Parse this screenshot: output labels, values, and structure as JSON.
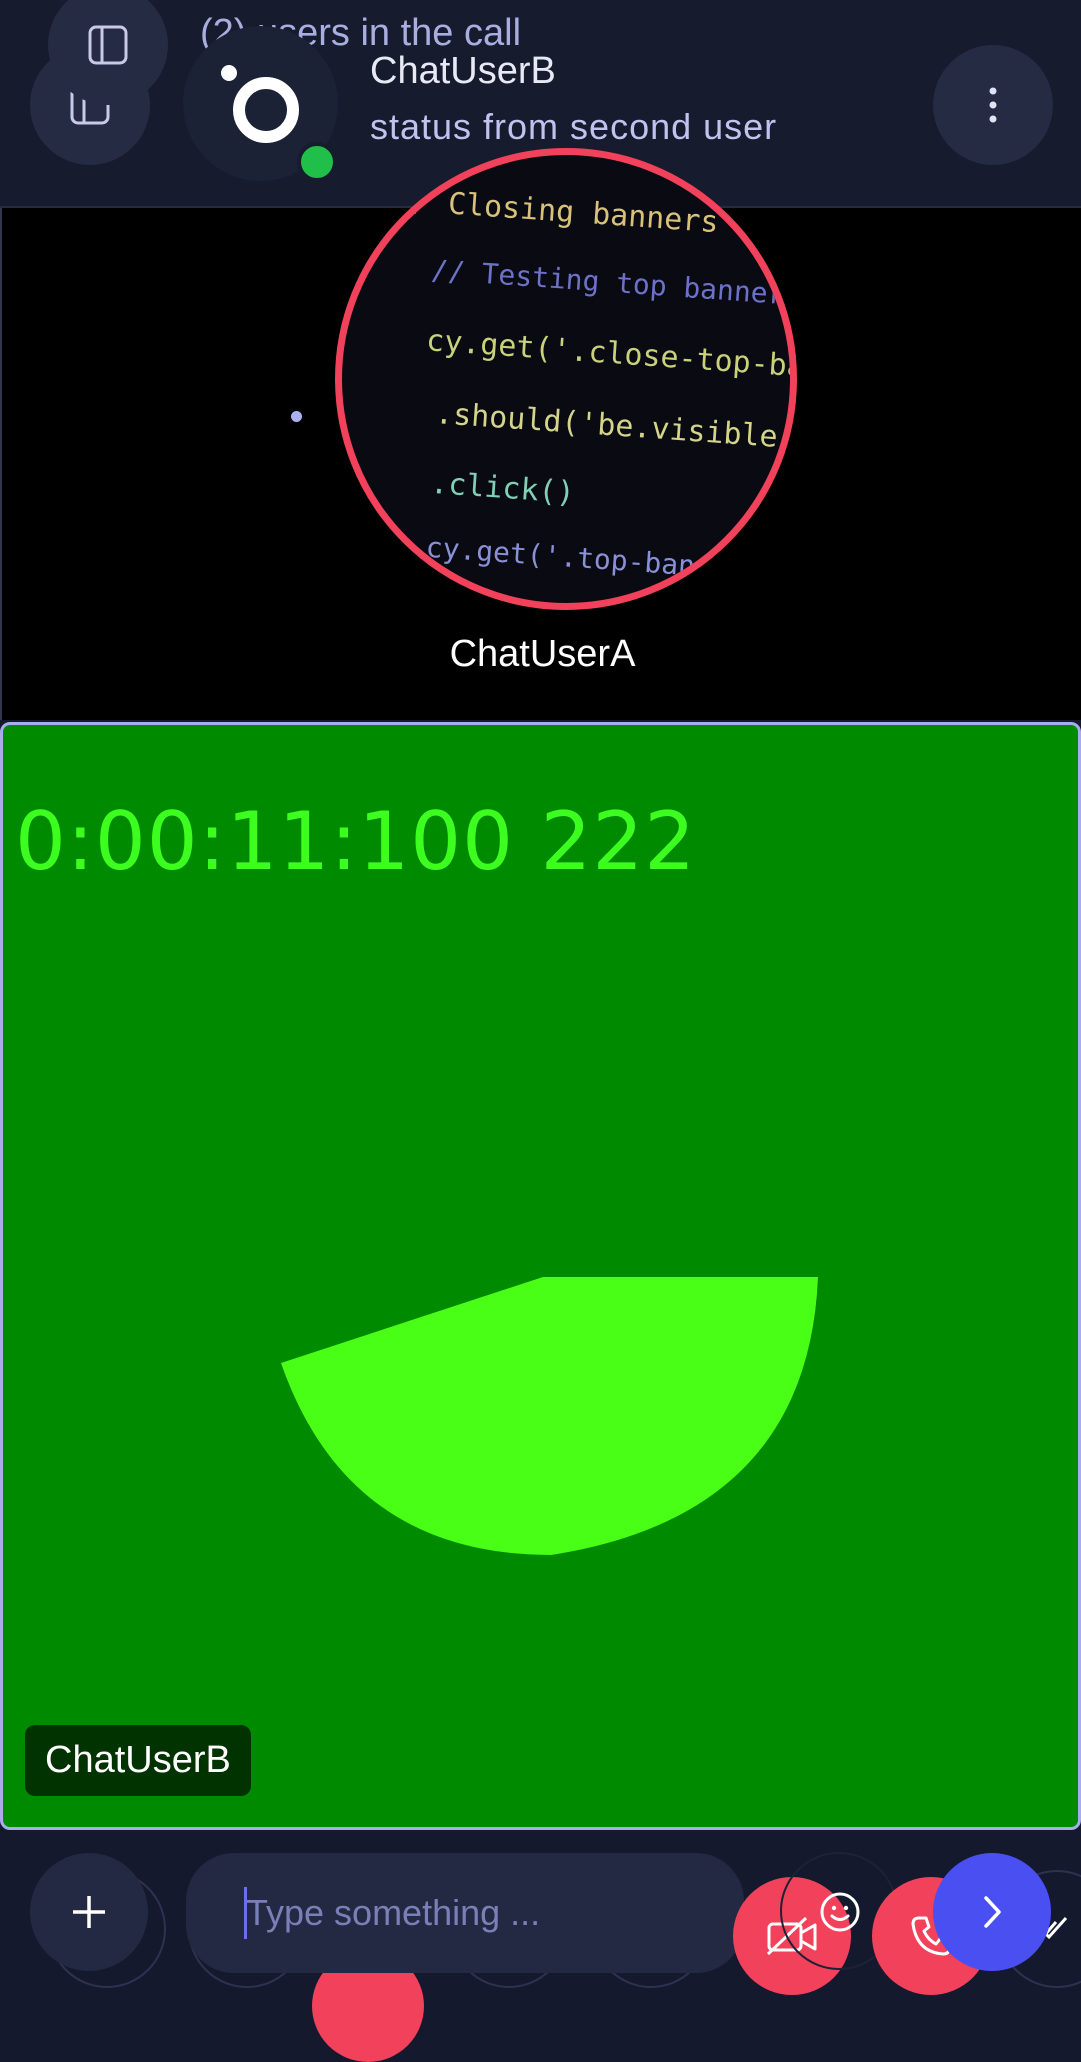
{
  "header": {
    "users_in_call": "(2) users in the call",
    "contact_name": "ChatUserB",
    "contact_status": "status from second user",
    "online": true
  },
  "call": {
    "remote_participant": {
      "name": "ChatUserA",
      "avatar_code_lines": [
        "// Closing banners should close banners', () => {",
        "// Testing top banner",
        "cy.get('.close-top-banner-btn')",
        ".should('be.visible')",
        ".click()",
        "cy.get('.top-banner')"
      ]
    },
    "local_participant": {
      "name": "ChatUserB",
      "video_timestamp": "0:00:11:100 222"
    }
  },
  "composer": {
    "placeholder": "Type something ..."
  },
  "colors": {
    "accent": "#4a4ff2",
    "danger": "#f2415a",
    "online": "#1fbf4a",
    "local_video_bg": "#008a00",
    "local_video_shape": "#49ff16"
  },
  "icons": {
    "sidebar_toggle": "sidebar-icon",
    "more_options": "more-vertical-icon",
    "add": "plus-icon",
    "emoji": "emoji-icon",
    "video_off": "video-off-icon",
    "phone": "phone-icon",
    "send": "chevron-right-icon",
    "read_receipt": "double-check-icon"
  }
}
